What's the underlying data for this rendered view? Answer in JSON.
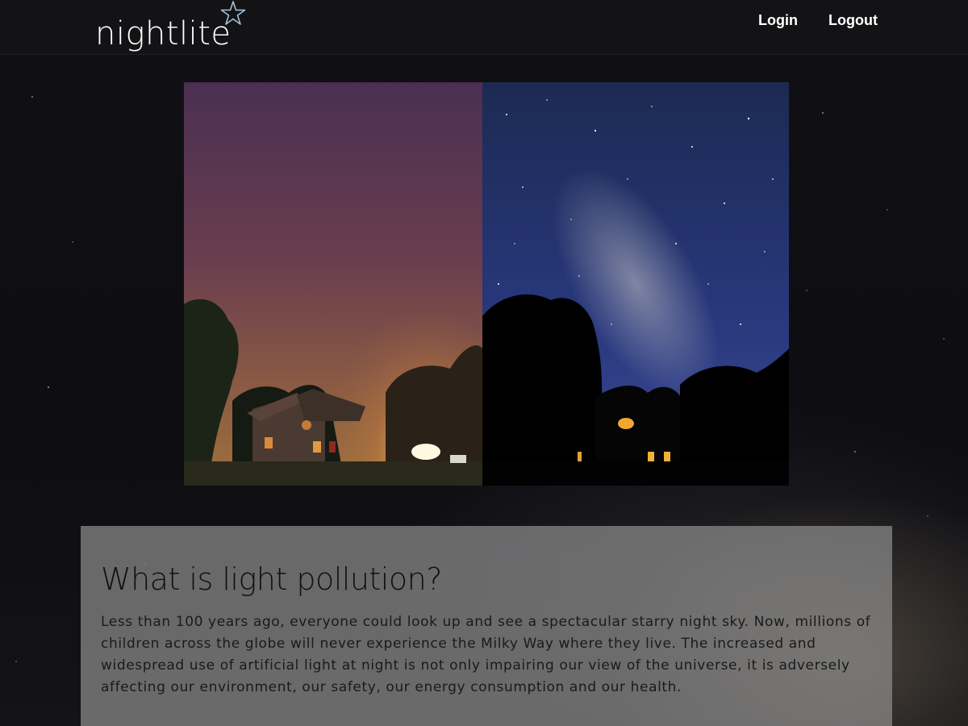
{
  "header": {
    "logo_text": "nightlite",
    "logo_icon": "star-outline-icon",
    "nav": {
      "login_label": "Login",
      "logout_label": "Logout"
    }
  },
  "hero": {
    "left_photo": "light-polluted-sky-house-photo",
    "right_photo": "dark-sky-milky-way-photo"
  },
  "info": {
    "title": "What is light pollution?",
    "body": "Less than 100 years ago, everyone could look up and see a spectacular starry night sky. Now, millions of children across the globe will never experience the Milky Way where they live. The increased and widespread use of artificial light at night is not only impairing our view of the universe, it is adversely affecting our environment, our safety, our energy consumption and our health."
  },
  "colors": {
    "header_bg": "#141416",
    "text_light": "#ffffff",
    "panel_bg": "#8c8c8c",
    "text_dark": "#111111"
  }
}
